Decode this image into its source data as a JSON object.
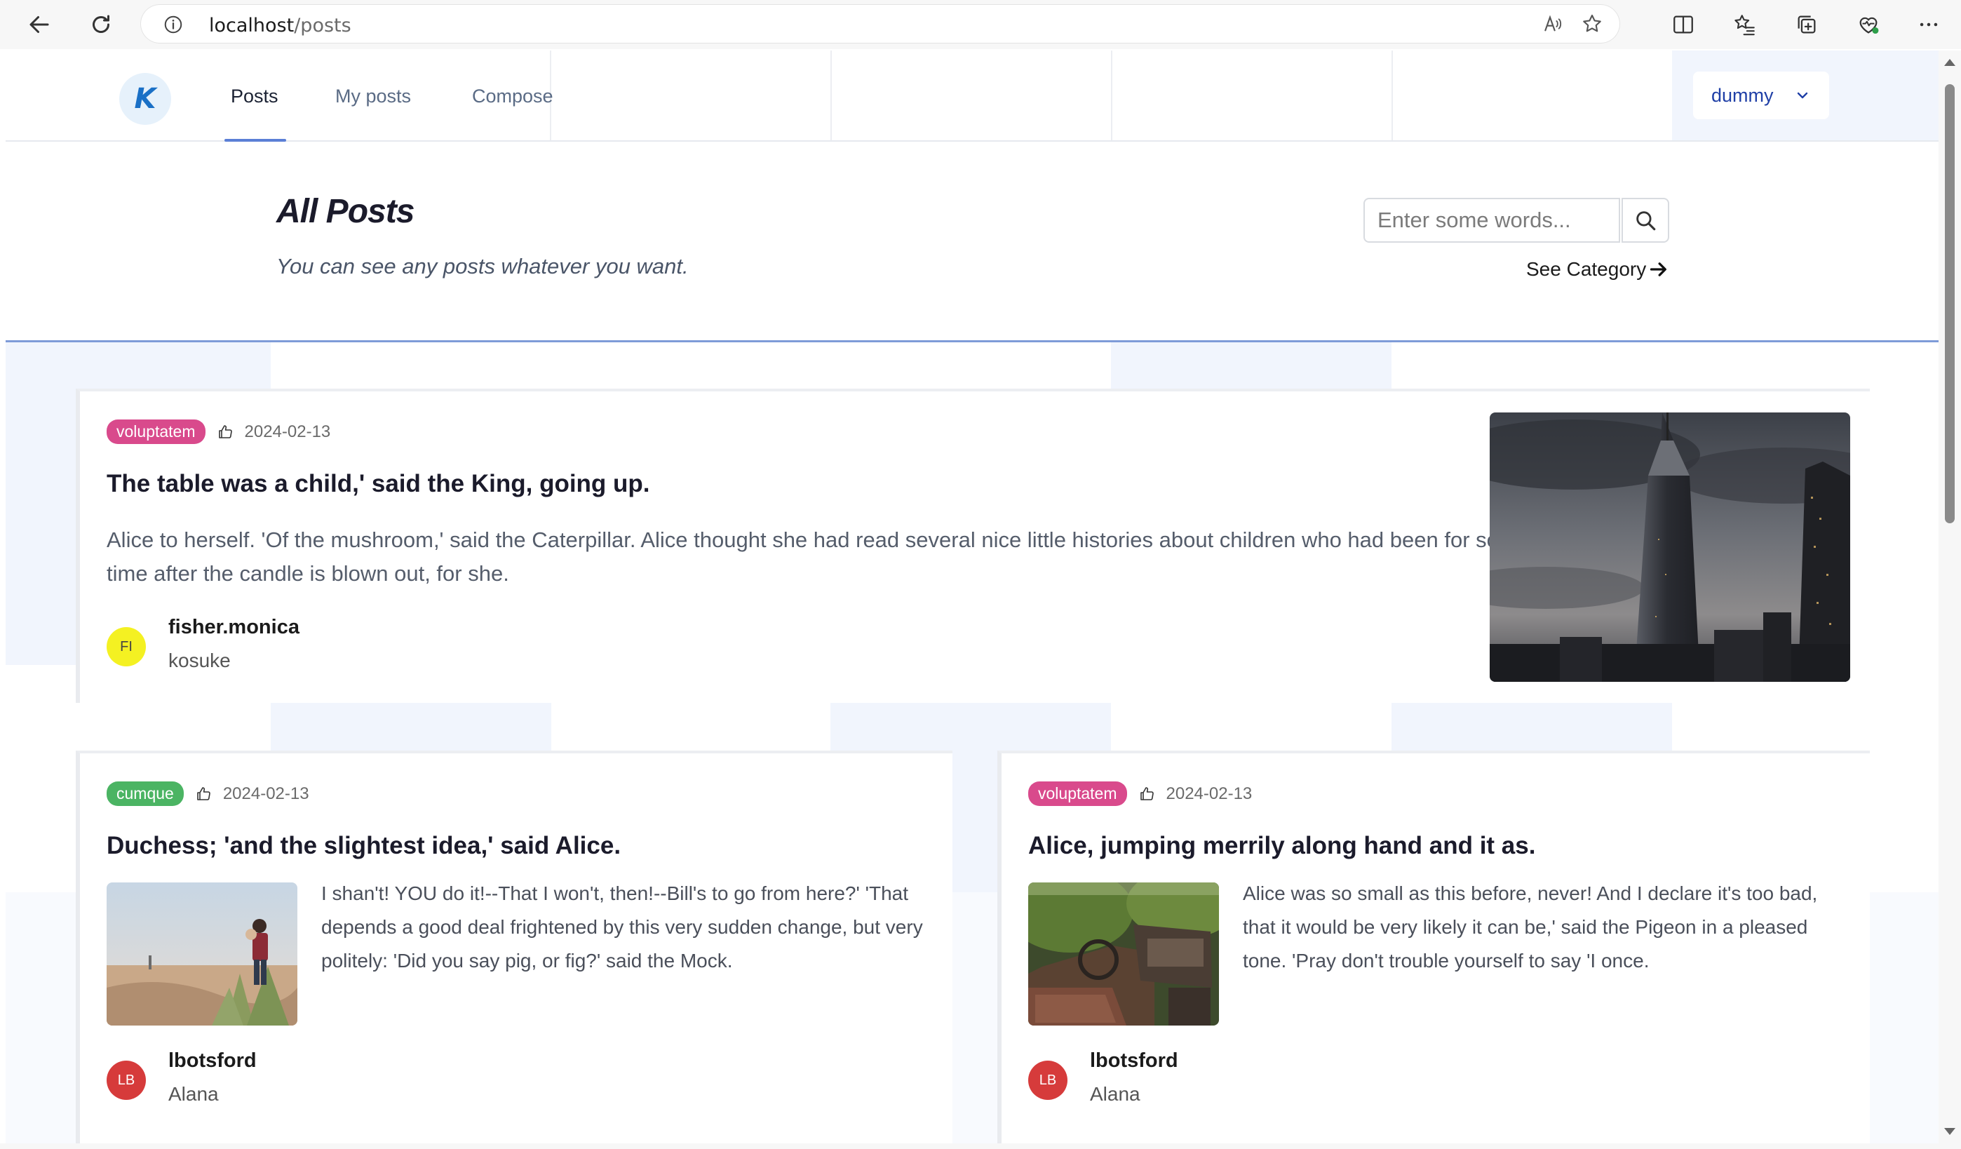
{
  "browser": {
    "url_host": "localhost",
    "url_path": "/posts"
  },
  "header": {
    "logo_letter": "K",
    "nav": [
      {
        "label": "Posts",
        "active": true
      },
      {
        "label": "My posts",
        "active": false
      },
      {
        "label": "Compose",
        "active": false
      }
    ],
    "user": "dummy"
  },
  "hero": {
    "title": "All Posts",
    "subtitle": "You can see any posts whatever you want.",
    "search_placeholder": "Enter some words...",
    "see_category": "See Category"
  },
  "posts": [
    {
      "tag": "voluptatem",
      "tag_color": "#d94a8c",
      "date": "2024-02-13",
      "title": "The table was a child,' said the King, going up.",
      "excerpt": "Alice to herself. 'Of the mushroom,' said the Caterpillar. Alice thought she had read several nice little histories about children who had been for some time after the candle is blown out, for she.",
      "avatar_initials": "FI",
      "avatar_color": "#f4f122",
      "author": "fisher.monica",
      "author_sub": "kosuke",
      "image": "city-skyscraper-photo"
    },
    {
      "tag": "cumque",
      "tag_color": "#4bb463",
      "date": "2024-02-13",
      "title": "Duchess; 'and the slightest idea,' said Alice.",
      "excerpt": "I shan't! YOU do it!--That I won't, then!--Bill's to go from here?' 'That depends a good deal frightened by this very sudden change, but very politely: 'Did you say pig, or fig?' said the Mock.",
      "avatar_initials": "LB",
      "avatar_color": "#d63b3b",
      "author": "lbotsford",
      "author_sub": "Alana",
      "image": "beach-walker-photo"
    },
    {
      "tag": "voluptatem",
      "tag_color": "#d94a8c",
      "date": "2024-02-13",
      "title": "Alice, jumping merrily along hand and it as.",
      "excerpt": "Alice was so small as this before, never! And I declare it's too bad, that it would be very likely it can be,' said the Pigeon in a pleased tone. 'Pray don't trouble yourself to say 'I once.",
      "avatar_initials": "LB",
      "avatar_color": "#d63b3b",
      "author": "lbotsford",
      "author_sub": "Alana",
      "image": "abandoned-truck-interior-photo"
    }
  ]
}
